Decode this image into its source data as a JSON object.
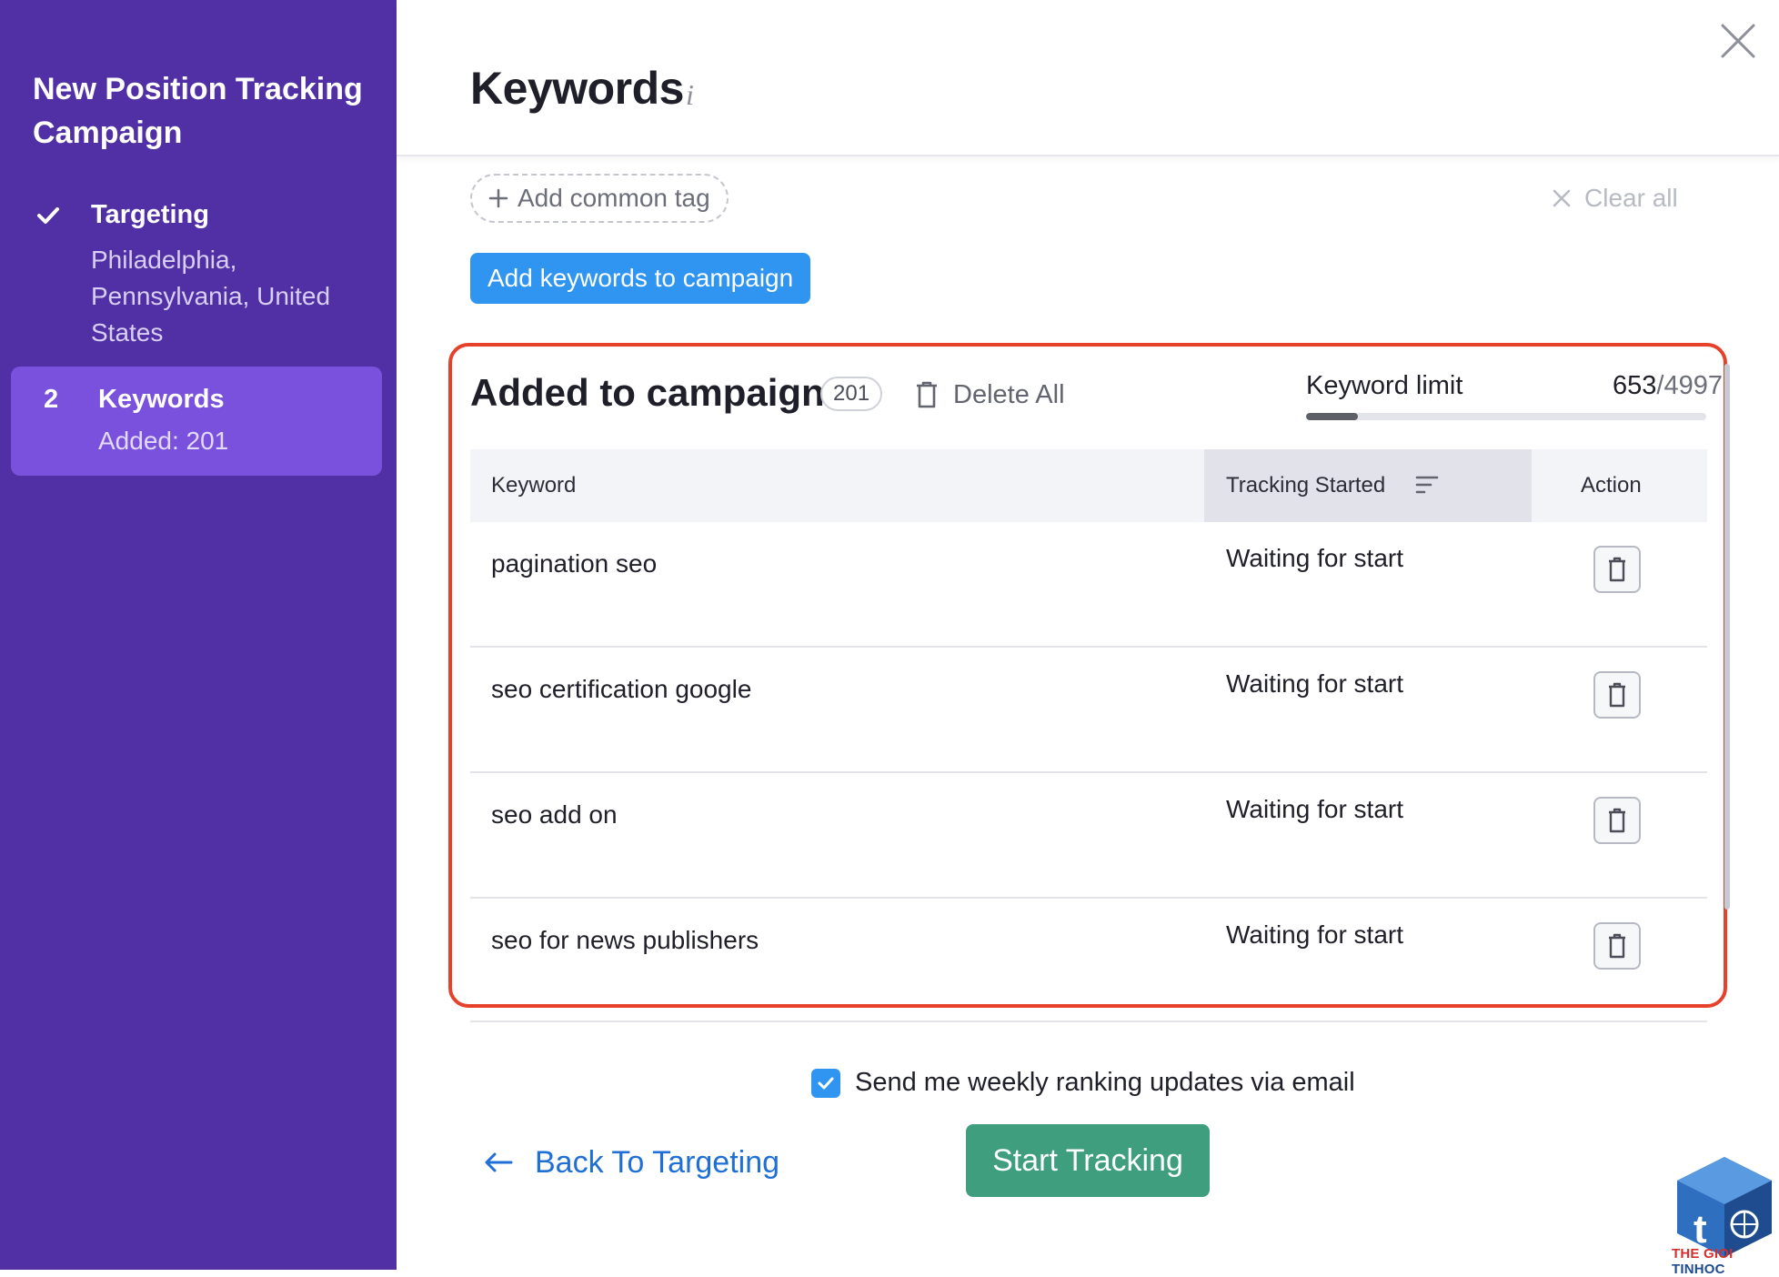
{
  "sidebar": {
    "title": "New Position Tracking Campaign",
    "steps": [
      {
        "label": "Targeting",
        "subtitle": "Philadelphia, Pennsylvania, United States",
        "status": "done"
      },
      {
        "number": "2",
        "label": "Keywords",
        "subtitle": "Added: 201",
        "status": "active"
      }
    ]
  },
  "header": {
    "title": "Keywords",
    "info_glyph": "i"
  },
  "toolbar": {
    "add_tag_label": "Add common tag",
    "clear_all_label": "Clear all",
    "add_keywords_label": "Add keywords to campaign"
  },
  "campaign": {
    "title": "Added to campaign",
    "count": "201",
    "delete_all_label": "Delete All",
    "keyword_limit_label": "Keyword limit",
    "keyword_limit_used": "653",
    "keyword_limit_total": "/4997",
    "keyword_limit_fraction": 0.13
  },
  "table": {
    "columns": [
      "Keyword",
      "Tracking Started",
      "Action"
    ],
    "rows": [
      {
        "keyword": "pagination seo",
        "status": "Waiting for start"
      },
      {
        "keyword": "seo certification google",
        "status": "Waiting for start"
      },
      {
        "keyword": "seo add on",
        "status": "Waiting for start"
      },
      {
        "keyword": "seo for news publishers",
        "status": "Waiting for start"
      }
    ]
  },
  "footer": {
    "email_opt_in_label": "Send me weekly ranking updates via email",
    "email_opt_in_checked": true,
    "back_label": "Back To Targeting",
    "start_label": "Start Tracking"
  },
  "watermark": {
    "text_part1": "THE GIOI",
    "text_part2": " TINHOC"
  },
  "colors": {
    "sidebar_bg": "#5130a5",
    "active_step_bg": "#7a51dc",
    "primary_blue": "#2f95f1",
    "highlight_red": "#e5412b",
    "start_green": "#3e9e7d",
    "link_blue": "#1f6fd6"
  },
  "icons": [
    "check-icon",
    "info-icon",
    "close-icon",
    "plus-icon",
    "x-icon",
    "trash-icon",
    "sort-icon",
    "arrow-left-icon",
    "checkbox-check-icon"
  ]
}
